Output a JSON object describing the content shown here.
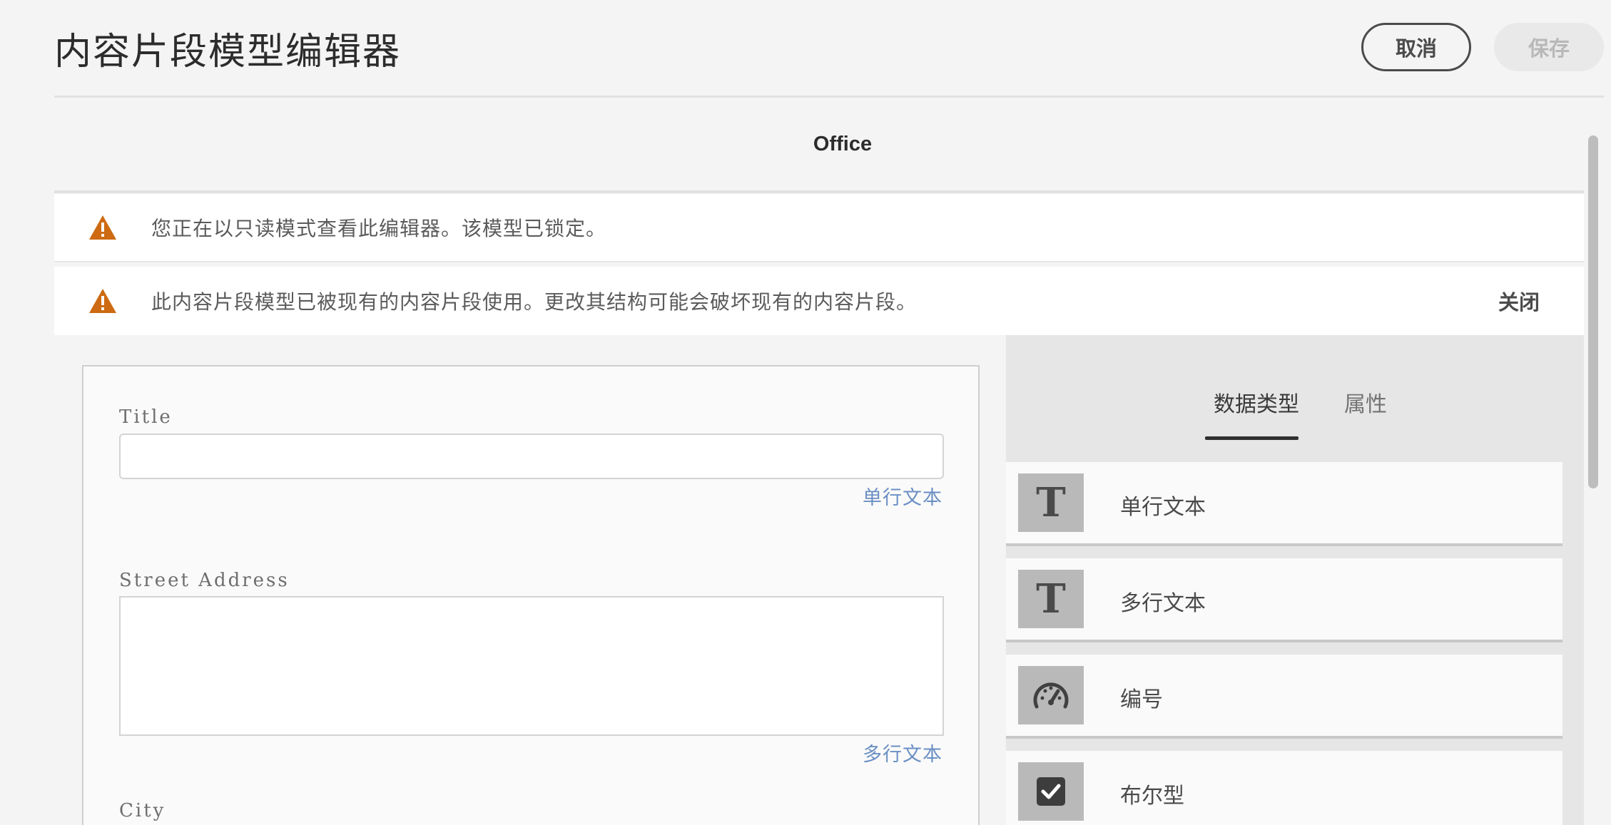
{
  "header": {
    "title": "内容片段模型编辑器",
    "cancel_label": "取消",
    "save_label": "保存"
  },
  "model": {
    "name": "Office"
  },
  "alerts": [
    {
      "icon": "warning-icon",
      "text": "您正在以只读模式查看此编辑器。该模型已锁定。"
    },
    {
      "icon": "warning-icon",
      "text": "此内容片段模型已被现有的内容片段使用。更改其结构可能会破坏现有的内容片段。",
      "close_label": "关闭"
    }
  ],
  "form": {
    "fields": [
      {
        "label": "Title",
        "type": "单行文本"
      },
      {
        "label": "Street Address",
        "type": "多行文本"
      },
      {
        "label": "City"
      }
    ]
  },
  "panel": {
    "tabs": [
      {
        "label": "数据类型",
        "active": true
      },
      {
        "label": "属性",
        "active": false
      }
    ],
    "types": [
      {
        "label": "单行文本",
        "icon": "text-icon"
      },
      {
        "label": "多行文本",
        "icon": "text-icon"
      },
      {
        "label": "编号",
        "icon": "gauge-icon"
      },
      {
        "label": "布尔型",
        "icon": "checkbox-icon"
      }
    ]
  },
  "colors": {
    "warning": "#cd6a12",
    "link_blue": "#6a8fc4"
  }
}
